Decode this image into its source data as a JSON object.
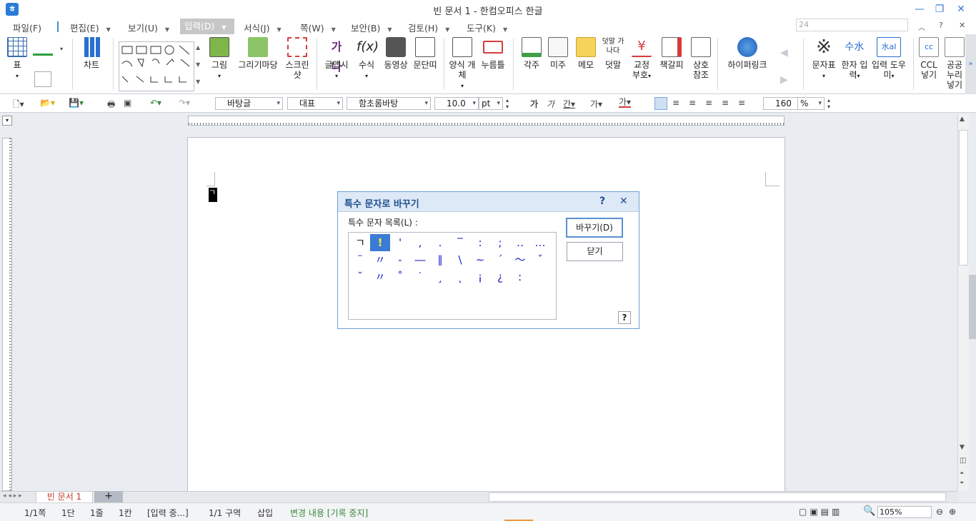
{
  "window": {
    "title": "빈 문서 1 - 한컴오피스 한글",
    "zoom_field": "24"
  },
  "menu": [
    {
      "label": "파일(F)",
      "arrow": false
    },
    {
      "label": "편집(E)",
      "arrow": true
    },
    {
      "label": "보기(U)",
      "arrow": true
    },
    {
      "label": "입력(D)",
      "arrow": true
    },
    {
      "label": "서식(J)",
      "arrow": true
    },
    {
      "label": "쪽(W)",
      "arrow": true
    },
    {
      "label": "보안(B)",
      "arrow": true
    },
    {
      "label": "검토(H)",
      "arrow": true
    },
    {
      "label": "도구(K)",
      "arrow": true
    }
  ],
  "ribbon": {
    "table": "표",
    "chart": "차트",
    "picture": "그림",
    "drawing_mart": "그리기마당",
    "screenshot": "스크린샷",
    "glyph_art": "글맵시",
    "formula": "수식",
    "video": "동영상",
    "column": "문단띠",
    "form_object": "양식 개체",
    "button": "누름틀",
    "footnote": "각주",
    "endnote": "미주",
    "memo": "메모",
    "overlay": "덧말",
    "overlay_icon_text": "덧말 가나다",
    "proofread": "교정 부호",
    "bookmark": "책갈피",
    "cross_ref": "상호 참조",
    "hyperlink": "하이퍼링크",
    "char_map": "문자표",
    "hanja": "한자 입력",
    "input_helper": "입력 도우미",
    "ccl": "CCL 넣기",
    "public": "공공누리 넣기"
  },
  "toolbar": {
    "style": "바탕글",
    "lang": "대표",
    "font": "함초롬바탕",
    "size": "10.0",
    "unit": "pt",
    "zoom": "160",
    "zoom_unit": "%"
  },
  "dialog": {
    "title": "특수 문자로 바꾸기",
    "help": "?",
    "close": "✕",
    "list_label": "특수 문자 목록(L) :",
    "replace_btn": "바꾸기(D)",
    "close_btn": "닫기",
    "help_btn": "?",
    "chars": [
      "ㄱ",
      "!",
      "'",
      ",",
      ".",
      "‾",
      ":",
      ";",
      "‥",
      "…",
      "¨",
      "〃",
      "-",
      "―",
      "∥",
      "\\",
      "∼",
      "´",
      "～",
      "ˇ",
      "˘",
      "〃",
      "˚",
      "˙",
      "¸",
      "˛",
      "¡",
      "¿",
      "ː"
    ],
    "selected": 1
  },
  "tabs": {
    "doc": "빈 문서 1",
    "add": "+"
  },
  "status": {
    "page": "1/1쪽",
    "col": "1단",
    "line": "1줄",
    "cell": "1칸",
    "mode": "[입력 중...]",
    "section": "1/1 구역",
    "insert": "삽입",
    "track": "변경 내용 [기록 중지]",
    "zoom": "105%"
  }
}
